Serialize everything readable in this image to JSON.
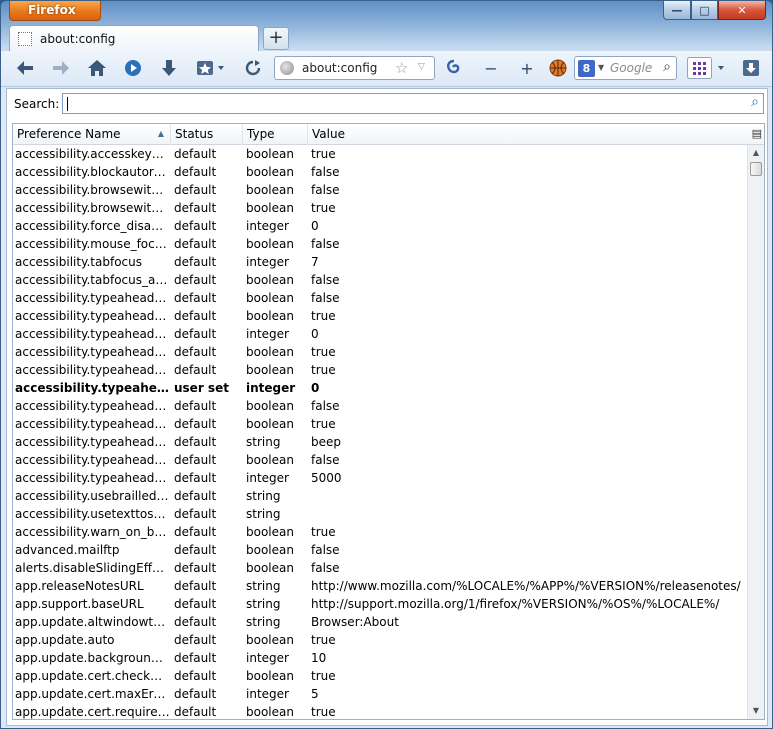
{
  "window": {
    "app_button": "Firefox",
    "controls": {
      "minimize": "—",
      "maximize": "□",
      "close": "✕"
    }
  },
  "tabs": [
    {
      "label": "about:config"
    }
  ],
  "new_tab": "+",
  "nav": {
    "back": "◀",
    "forward": "▶",
    "home": "⌂",
    "play": "●",
    "download": "⬇",
    "bookmark": "★",
    "reload": "↻",
    "zoom_out": "−",
    "zoom_in": "+",
    "url": "about:config",
    "search_engine": "8",
    "search_placeholder": "Google",
    "downloads_panel": "⬇"
  },
  "config": {
    "search_label": "Search:",
    "search_value": "",
    "columns": [
      "Preference Name",
      "Status",
      "Type",
      "Value"
    ],
    "rows": [
      {
        "name": "accessibility.accesskeycaus...",
        "status": "default",
        "type": "boolean",
        "value": "true"
      },
      {
        "name": "accessibility.blockautorefresh",
        "status": "default",
        "type": "boolean",
        "value": "false"
      },
      {
        "name": "accessibility.browsewithcaret",
        "status": "default",
        "type": "boolean",
        "value": "false"
      },
      {
        "name": "accessibility.browsewithcar...",
        "status": "default",
        "type": "boolean",
        "value": "true"
      },
      {
        "name": "accessibility.force_disabled",
        "status": "default",
        "type": "integer",
        "value": "0"
      },
      {
        "name": "accessibility.mouse_focuse...",
        "status": "default",
        "type": "boolean",
        "value": "false"
      },
      {
        "name": "accessibility.tabfocus",
        "status": "default",
        "type": "integer",
        "value": "7"
      },
      {
        "name": "accessibility.tabfocus_appli...",
        "status": "default",
        "type": "boolean",
        "value": "false"
      },
      {
        "name": "accessibility.typeaheadfind",
        "status": "default",
        "type": "boolean",
        "value": "false"
      },
      {
        "name": "accessibility.typeaheadfind....",
        "status": "default",
        "type": "boolean",
        "value": "true"
      },
      {
        "name": "accessibility.typeaheadfind....",
        "status": "default",
        "type": "integer",
        "value": "0"
      },
      {
        "name": "accessibility.typeaheadfind....",
        "status": "default",
        "type": "boolean",
        "value": "true"
      },
      {
        "name": "accessibility.typeaheadfind....",
        "status": "default",
        "type": "boolean",
        "value": "true"
      },
      {
        "name": "accessibility.typeaheadfin...",
        "status": "user set",
        "type": "integer",
        "value": "0",
        "userset": true
      },
      {
        "name": "accessibility.typeaheadfind....",
        "status": "default",
        "type": "boolean",
        "value": "false"
      },
      {
        "name": "accessibility.typeaheadfind....",
        "status": "default",
        "type": "boolean",
        "value": "true"
      },
      {
        "name": "accessibility.typeaheadfind....",
        "status": "default",
        "type": "string",
        "value": "beep"
      },
      {
        "name": "accessibility.typeaheadfind....",
        "status": "default",
        "type": "boolean",
        "value": "false"
      },
      {
        "name": "accessibility.typeaheadfind....",
        "status": "default",
        "type": "integer",
        "value": "5000"
      },
      {
        "name": "accessibility.usebrailledisplay",
        "status": "default",
        "type": "string",
        "value": ""
      },
      {
        "name": "accessibility.usetexttospeech",
        "status": "default",
        "type": "string",
        "value": ""
      },
      {
        "name": "accessibility.warn_on_brow...",
        "status": "default",
        "type": "boolean",
        "value": "true"
      },
      {
        "name": "advanced.mailftp",
        "status": "default",
        "type": "boolean",
        "value": "false"
      },
      {
        "name": "alerts.disableSlidingEffect",
        "status": "default",
        "type": "boolean",
        "value": "false"
      },
      {
        "name": "app.releaseNotesURL",
        "status": "default",
        "type": "string",
        "value": "http://www.mozilla.com/%LOCALE%/%APP%/%VERSION%/releasenotes/"
      },
      {
        "name": "app.support.baseURL",
        "status": "default",
        "type": "string",
        "value": "http://support.mozilla.org/1/firefox/%VERSION%/%OS%/%LOCALE%/"
      },
      {
        "name": "app.update.altwindowtype",
        "status": "default",
        "type": "string",
        "value": "Browser:About"
      },
      {
        "name": "app.update.auto",
        "status": "default",
        "type": "boolean",
        "value": "true"
      },
      {
        "name": "app.update.backgroundMa...",
        "status": "default",
        "type": "integer",
        "value": "10"
      },
      {
        "name": "app.update.cert.checkAttri...",
        "status": "default",
        "type": "boolean",
        "value": "true"
      },
      {
        "name": "app.update.cert.maxErrors",
        "status": "default",
        "type": "integer",
        "value": "5"
      },
      {
        "name": "app.update.cert.requireBuil...",
        "status": "default",
        "type": "boolean",
        "value": "true"
      }
    ]
  },
  "colors": {
    "accent": "#e8781c",
    "frame": "#dde9f6"
  }
}
